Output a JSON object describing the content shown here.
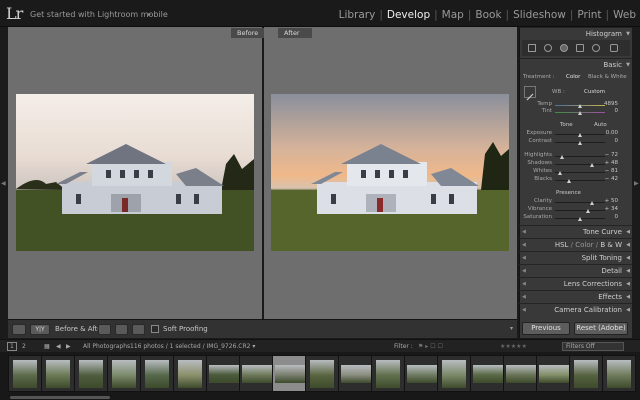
{
  "app": {
    "logo": "Lr",
    "mobile_link": "Get started with Lightroom mobile",
    "mobile_caret": "▸"
  },
  "modules": [
    {
      "label": "Library"
    },
    {
      "label": "Develop"
    },
    {
      "label": "Map"
    },
    {
      "label": "Book"
    },
    {
      "label": "Slideshow"
    },
    {
      "label": "Print"
    },
    {
      "label": "Web"
    }
  ],
  "active_module": "Develop",
  "view": {
    "before_label": "Before",
    "after_label": "After"
  },
  "toolbar": {
    "before_after_label": "Before & After :",
    "soft_proofing_label": "Soft Proofing",
    "yy_label": "Y|Y"
  },
  "panel": {
    "histogram": "Histogram",
    "basic": "Basic",
    "treatment_label": "Treatment :",
    "treatment_color": "Color",
    "treatment_bw": "Black & White",
    "wb_label": "WB :",
    "wb_value": "Custom",
    "temp": {
      "label": "Temp",
      "value": "4895",
      "pos": 0.5
    },
    "tint": {
      "label": "Tint",
      "value": "0",
      "pos": 0.5
    },
    "tone_label": "Tone",
    "auto_label": "Auto",
    "exposure": {
      "label": "Exposure",
      "value": "0.00",
      "pos": 0.5
    },
    "contrast": {
      "label": "Contrast",
      "value": "0",
      "pos": 0.5
    },
    "highlights": {
      "label": "Highlights",
      "value": "− 72",
      "pos": 0.14
    },
    "shadows": {
      "label": "Shadows",
      "value": "+ 48",
      "pos": 0.74
    },
    "whites": {
      "label": "Whites",
      "value": "− 81",
      "pos": 0.1
    },
    "blacks": {
      "label": "Blacks",
      "value": "− 42",
      "pos": 0.29
    },
    "presence_label": "Presence",
    "clarity": {
      "label": "Clarity",
      "value": "+ 50",
      "pos": 0.75
    },
    "vibrance": {
      "label": "Vibrance",
      "value": "+ 34",
      "pos": 0.67
    },
    "saturation": {
      "label": "Saturation",
      "value": "0",
      "pos": 0.5
    },
    "sections": [
      "Tone Curve",
      "HSL / Color / B & W",
      "Split Toning",
      "Detail",
      "Lens Corrections",
      "Effects",
      "Camera Calibration"
    ],
    "hsl_parts": [
      "HSL",
      "Color",
      "B & W"
    ],
    "previous_label": "Previous",
    "reset_label": "Reset (Adobe)"
  },
  "filmbar": {
    "page1": "1",
    "page2": "2",
    "source": "All Photographs",
    "info": "116 photos / 1 selected / IMG_9726.CR2 ▾",
    "filter_label": "Filter :",
    "filters_off": "Filters Off"
  },
  "colors": {
    "accent_active": "#f0f0f0",
    "panel_bg": "#393939"
  }
}
